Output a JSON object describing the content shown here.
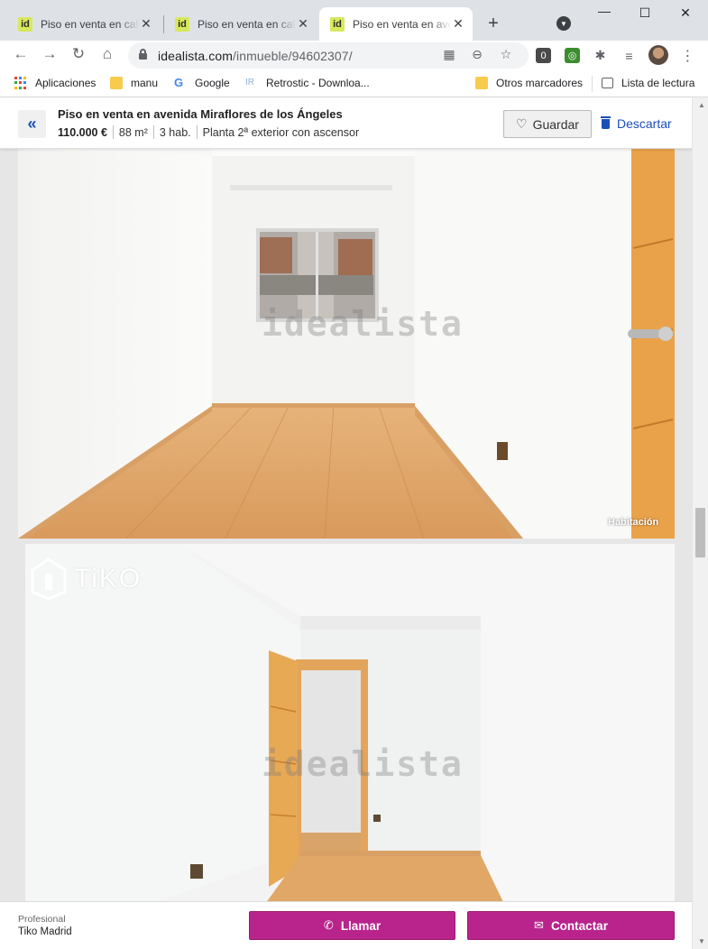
{
  "browser": {
    "tabs": [
      {
        "favicon": "id",
        "title": "Piso en venta en calle"
      },
      {
        "favicon": "id",
        "title": "Piso en venta en calle"
      },
      {
        "favicon": "id",
        "title": "Piso en venta en avenida"
      }
    ],
    "active_tab": 2,
    "url_host": "idealista.com",
    "url_path": "/inmueble/94602307/",
    "bookmarks": [
      {
        "icon": "apps-icon",
        "label": "Aplicaciones"
      },
      {
        "icon": "folder-icon",
        "label": "manu"
      },
      {
        "icon": "google-icon",
        "label": "Google"
      },
      {
        "icon": "retrostic-icon",
        "label": "Retrostic - Downloa..."
      },
      {
        "icon": "folder-icon",
        "label": "Otros marcadores"
      },
      {
        "icon": "reading-list-icon",
        "label": "Lista de lectura"
      }
    ]
  },
  "listing": {
    "title": "Piso en venta en avenida Miraflores de los Ángeles",
    "price": "110.000 €",
    "size": "88 m²",
    "rooms": "3 hab.",
    "floor": "Planta 2ª exterior con ascensor",
    "save_label": "Guardar",
    "discard_label": "Descartar",
    "back_glyph": "«"
  },
  "photos": [
    {
      "caption": "Habitación",
      "watermark": "idealista"
    },
    {
      "caption": "",
      "watermark": "idealista",
      "brand": "TiKO"
    }
  ],
  "contact": {
    "type_label": "Profesional",
    "agency": "Tiko Madrid",
    "call_label": "Llamar",
    "contact_label": "Contactar"
  },
  "colors": {
    "accent": "#1b4fb8",
    "cta": "#b8238c",
    "favicon_bg": "#d8e85c",
    "chrome_bg": "#dee1e6"
  }
}
